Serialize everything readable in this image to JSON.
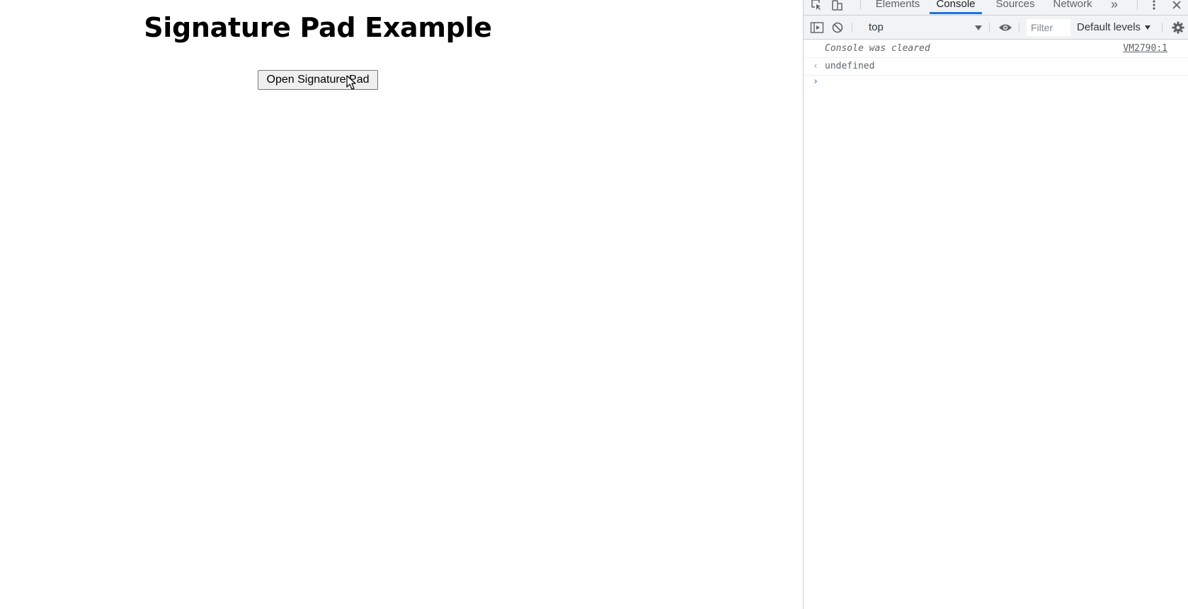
{
  "page": {
    "heading": "Signature Pad Example",
    "open_button_label": "Open Signature Pad"
  },
  "devtools": {
    "tabs": [
      {
        "label": "Elements",
        "active": false
      },
      {
        "label": "Console",
        "active": true
      },
      {
        "label": "Sources",
        "active": false
      },
      {
        "label": "Network",
        "active": false
      }
    ],
    "more_tabs_glyph": "»",
    "toolbar": {
      "context": "top",
      "filter_placeholder": "Filter",
      "levels_label": "Default levels"
    },
    "console": {
      "messages": [
        {
          "text": "Console was cleared",
          "source": "VM2790:1"
        },
        {
          "text": "undefined",
          "gutter": "‹"
        }
      ],
      "prompt": "›"
    }
  },
  "colors": {
    "accent": "#1a73e8",
    "devtools_bg": "#f1f3f4",
    "border": "#cbcdd1"
  }
}
